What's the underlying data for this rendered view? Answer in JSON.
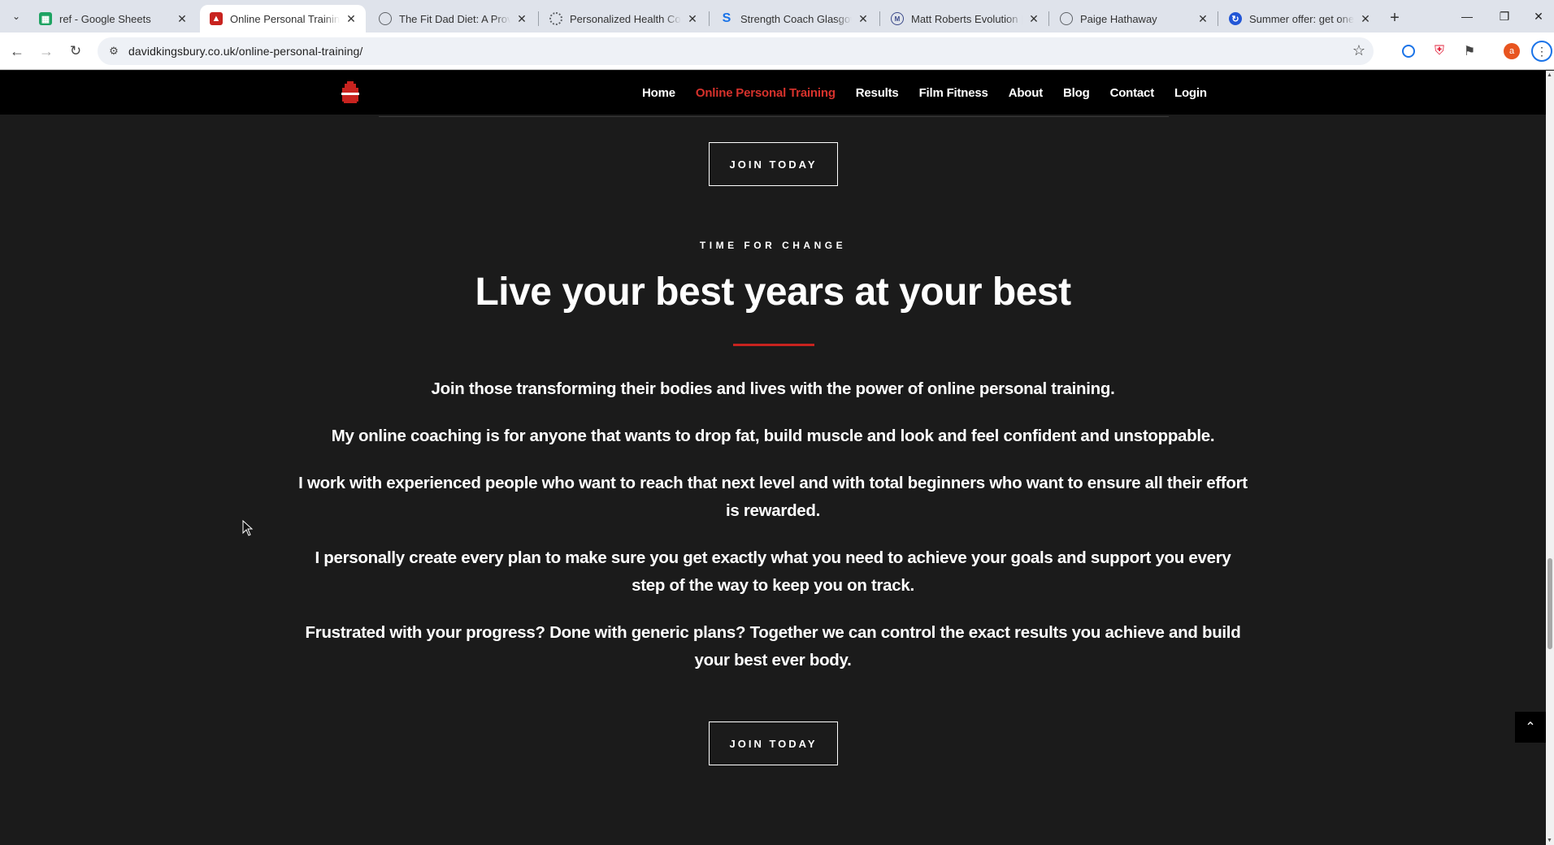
{
  "browser": {
    "tabs": [
      {
        "title": "ref - Google Sheets",
        "favicon": "sheets-icon",
        "color": "#1ea362"
      },
      {
        "title": "Online Personal Training |",
        "favicon": "kingsbury-icon",
        "color": "#c8231f"
      },
      {
        "title": "The Fit Dad Diet: A Prover",
        "favicon": "globe-icon",
        "color": "#5f6368"
      },
      {
        "title": "Personalized Health Coac",
        "favicon": "spinner-icon",
        "color": "#5f6368"
      },
      {
        "title": "Strength Coach Glasgow",
        "favicon": "s-brand-icon",
        "color": "#1a73e8"
      },
      {
        "title": "Matt Roberts Evolution | T",
        "favicon": "mr-icon",
        "color": "#3c4a8a"
      },
      {
        "title": "Paige Hathaway",
        "favicon": "globe-icon",
        "color": "#5f6368"
      },
      {
        "title": "Summer offer: get one m",
        "favicon": "blue-brand-icon",
        "color": "#2256d6"
      }
    ],
    "url": "davidkingsbury.co.uk/online-personal-training/"
  },
  "site": {
    "nav": [
      {
        "label": "Home",
        "current": false
      },
      {
        "label": "Online Personal Training",
        "current": true
      },
      {
        "label": "Results",
        "current": false
      },
      {
        "label": "Film Fitness",
        "current": false
      },
      {
        "label": "About",
        "current": false
      },
      {
        "label": "Blog",
        "current": false
      },
      {
        "label": "Contact",
        "current": false
      },
      {
        "label": "Login",
        "current": false
      }
    ],
    "accent_color": "#d6322c"
  },
  "content": {
    "join_label_top": "JOIN TODAY",
    "eyebrow": "TIME FOR CHANGE",
    "headline": "Live your best years at your best",
    "paragraphs": [
      "Join those transforming their bodies and lives with the power of online personal training.",
      "My online coaching is for anyone that wants to drop fat, build muscle and look and feel confident and unstoppable.",
      "I work with experienced people who want to reach that next level and with total beginners who want to ensure all their effort is rewarded.",
      "I personally create every plan to make sure you get exactly what you need to achieve your goals and support you every step of the way to keep you on track.",
      "Frustrated with your progress? Done with generic plans? Together we can control the exact results you achieve and build your best ever body."
    ],
    "join_label_bottom": "JOIN TODAY"
  }
}
